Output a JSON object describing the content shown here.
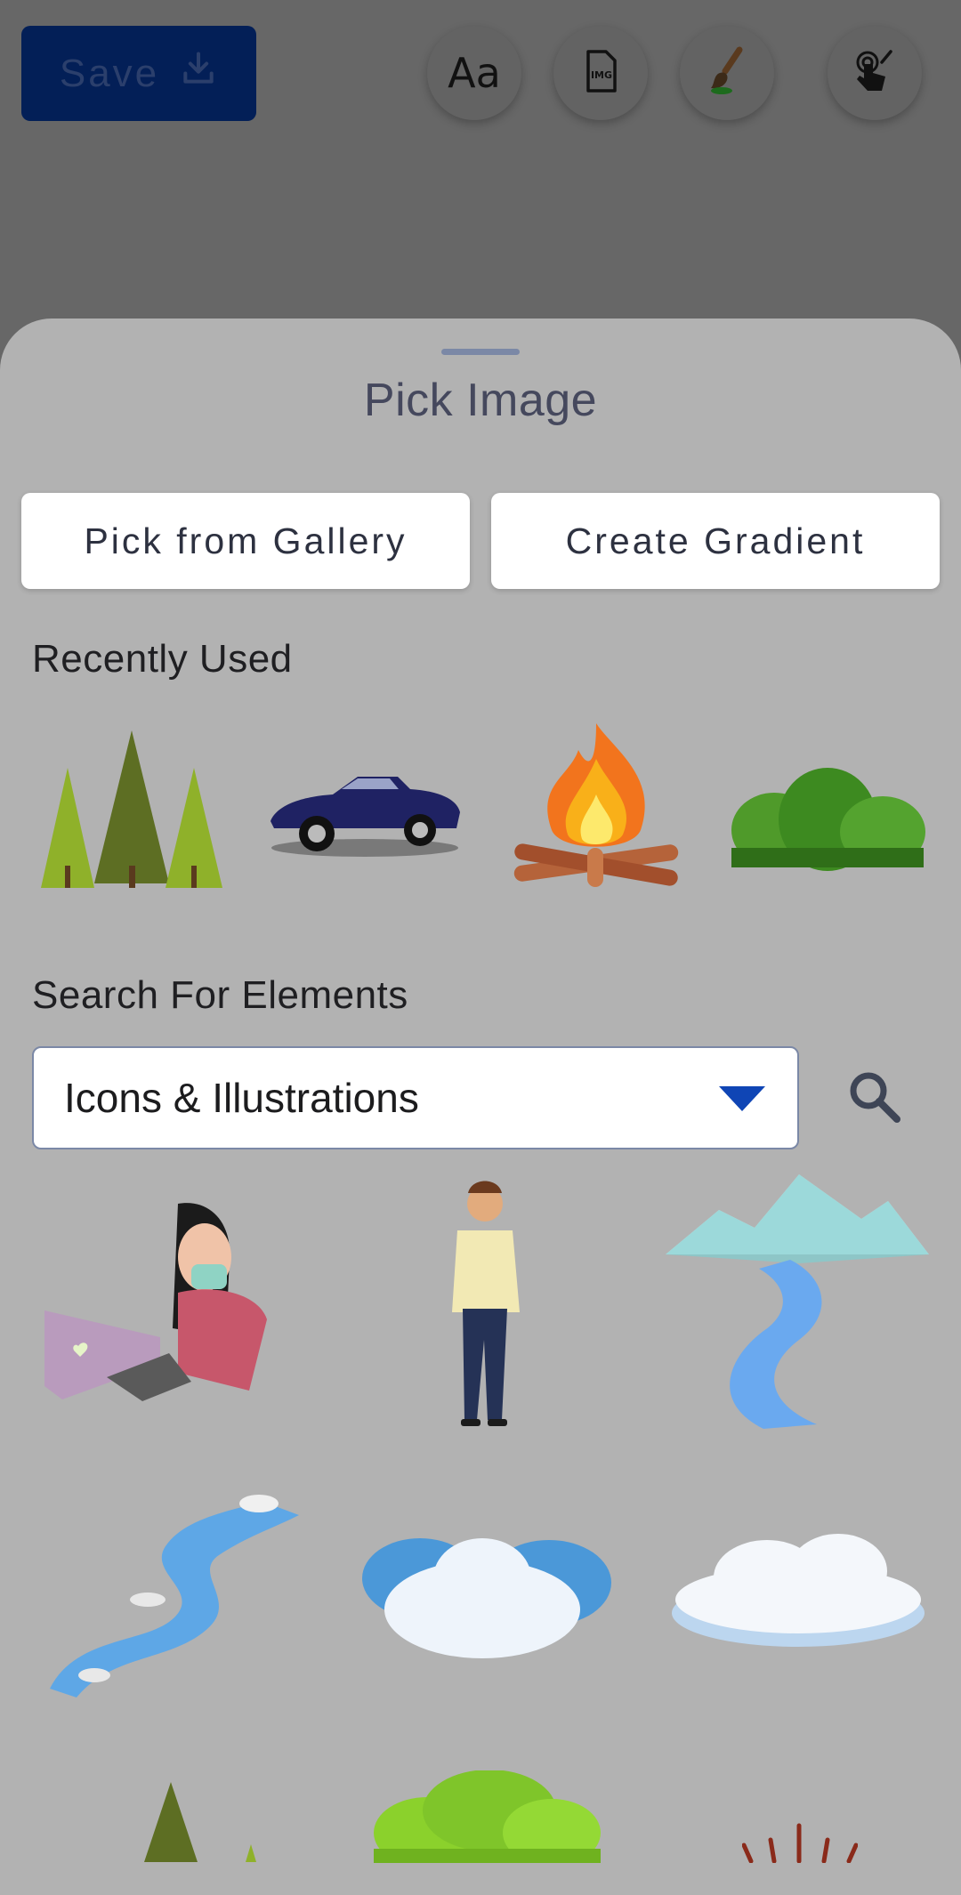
{
  "toolbar": {
    "save_label": "Save",
    "icons": [
      "download-icon",
      "text-tool-icon",
      "image-file-icon",
      "paint-brush-icon",
      "touch-edit-icon"
    ],
    "text_tool_glyph": "Aa",
    "image_tool_glyph": "IMG"
  },
  "sheet": {
    "title": "Pick Image",
    "pick_gallery_label": "Pick from Gallery",
    "create_gradient_label": "Create Gradient",
    "recently_used_label": "Recently Used",
    "recent_items": [
      "pine-trees",
      "sports-car",
      "campfire",
      "green-bush"
    ],
    "search_label": "Search For Elements",
    "category_select": {
      "selected": "Icons & Illustrations"
    },
    "elements": [
      "woman-with-laptop",
      "standing-man",
      "mountain-river",
      "winding-river",
      "blue-clouds",
      "white-cloud",
      "small-pine-tree",
      "green-shrub",
      "grass-tuft"
    ]
  },
  "colors": {
    "overlay": "#676767",
    "sheet": "#b2b2b2",
    "save_button": "#031f57",
    "accent": "#0f45b5"
  }
}
